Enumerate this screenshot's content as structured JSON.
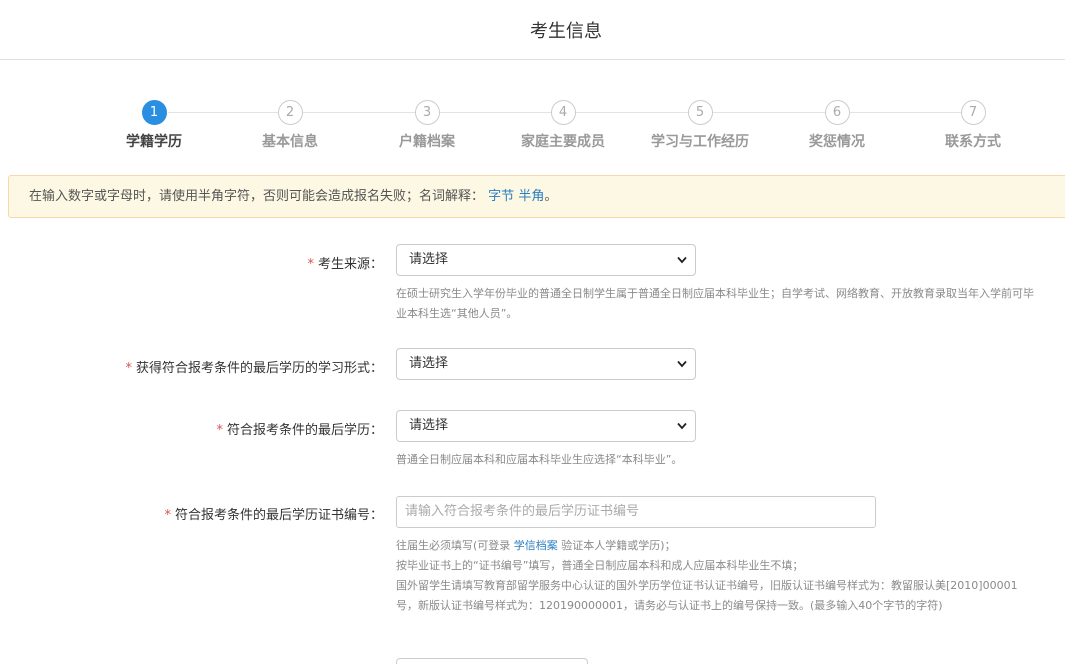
{
  "header": {
    "title": "考生信息"
  },
  "steps": [
    {
      "number": "1",
      "label": "学籍学历",
      "active": true
    },
    {
      "number": "2",
      "label": "基本信息",
      "active": false
    },
    {
      "number": "3",
      "label": "户籍档案",
      "active": false
    },
    {
      "number": "4",
      "label": "家庭主要成员",
      "active": false
    },
    {
      "number": "5",
      "label": "学习与工作经历",
      "active": false
    },
    {
      "number": "6",
      "label": "奖惩情况",
      "active": false
    },
    {
      "number": "7",
      "label": "联系方式",
      "active": false
    }
  ],
  "notice": {
    "text": "在输入数字或字母时，请使用半角字符，否则可能会造成报名失败；名词解释：",
    "link1": "字节",
    "link2": "半角",
    "end": "。"
  },
  "form": {
    "source": {
      "required_mark": "*",
      "label": "考生来源：",
      "value": "请选择",
      "help": "在硕士研究生入学年份毕业的普通全日制学生属于普通全日制应届本科毕业生；自学考试、网络教育、开放教育录取当年入学前可毕业本科生选“其他人员”。"
    },
    "study_form": {
      "required_mark": "*",
      "label": "获得符合报考条件的最后学历的学习形式：",
      "value": "请选择"
    },
    "last_degree": {
      "required_mark": "*",
      "label": "符合报考条件的最后学历：",
      "value": "请选择",
      "help": "普通全日制应届本科和应届本科毕业生应选择“本科毕业”。"
    },
    "cert_no": {
      "required_mark": "*",
      "label": "符合报考条件的最后学历证书编号：",
      "placeholder": "请输入符合报考条件的最后学历证书编号",
      "help_line1_a": "往届生必须填写(可登录",
      "help_line1_link": "学信档案",
      "help_line1_b": "验证本人学籍或学历)；",
      "help_line2": "按毕业证书上的“证书编号”填写，普通全日制应届本科和成人应届本科毕业生不填；",
      "help_line3": "国外留学生请填写教育部留学服务中心认证的国外学历学位证书认证书编号，旧版认证书编号样式为：教留服认美[2010]00001号，新版认证书编号样式为：120190000001，请务必与认证书上的编号保持一致。(最多输入40个字节的字符)"
    }
  }
}
